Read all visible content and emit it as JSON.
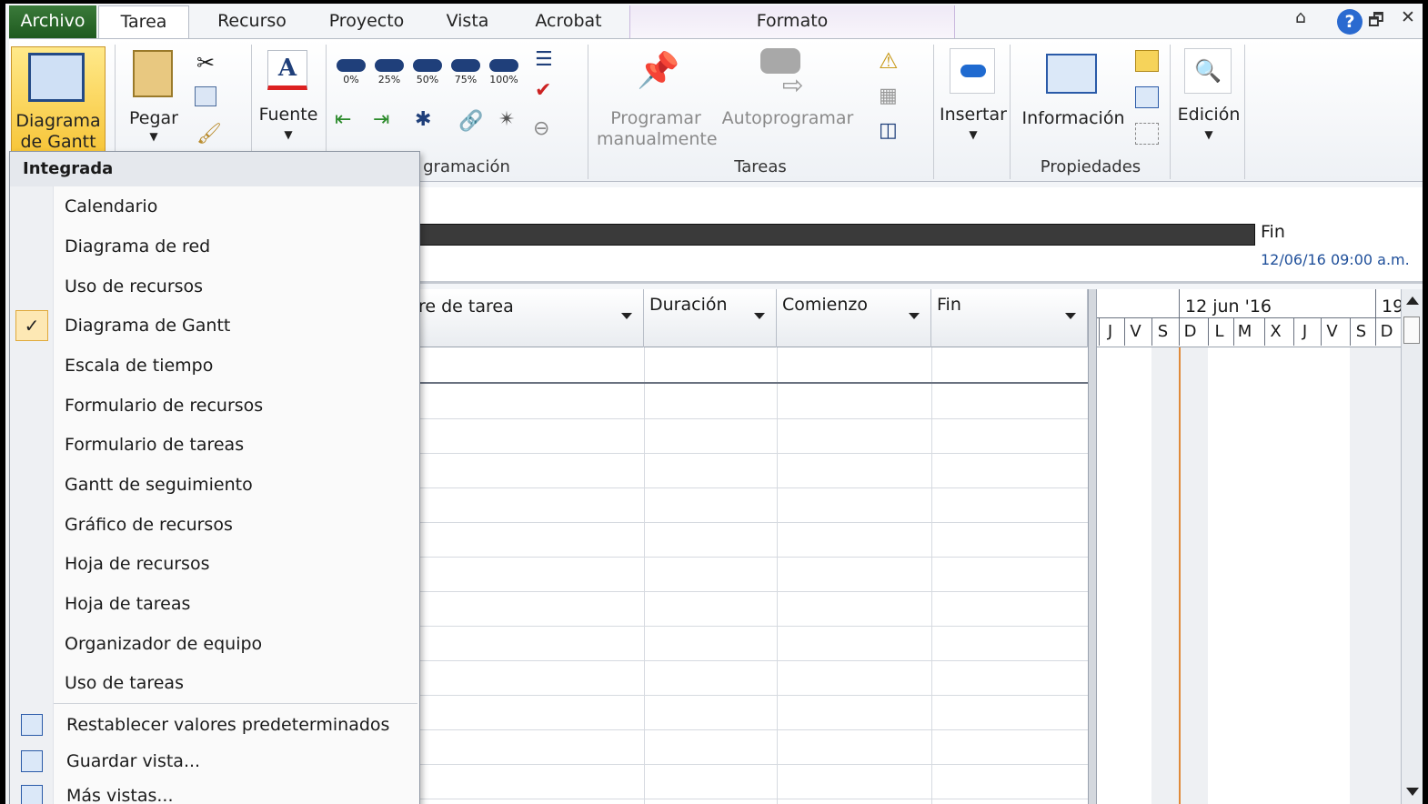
{
  "tabs": {
    "file": "Archivo",
    "task": "Tarea",
    "resource": "Recurso",
    "project": "Proyecto",
    "view": "Vista",
    "acrobat": "Acrobat",
    "format": "Formato"
  },
  "ribbon": {
    "gantt_label_1": "Diagrama",
    "gantt_label_2": "de Gantt",
    "paste": "Pegar",
    "font": "Fuente",
    "pct": [
      "0%",
      "25%",
      "50%",
      "75%",
      "100%"
    ],
    "schedule_group": "gramación",
    "manual_1": "Programar",
    "manual_2": "manualmente",
    "auto": "Autoprogramar",
    "tasks_group": "Tareas",
    "insert": "Insertar",
    "info": "Información",
    "properties_group": "Propiedades",
    "editing": "Edición"
  },
  "timeline": {
    "end_label": "Fin",
    "end_date": "12/06/16 09:00 a.m."
  },
  "grid": {
    "columns": [
      "re de tarea",
      "Duración",
      "Comienzo",
      "Fin"
    ]
  },
  "chart": {
    "week1": "12 jun '16",
    "week2": "19",
    "days": [
      "J",
      "V",
      "S",
      "D",
      "L",
      "M",
      "X",
      "J",
      "V",
      "S",
      "D"
    ]
  },
  "menu": {
    "header": "Integrada",
    "items": [
      "Calendario",
      "Diagrama de red",
      "Uso de recursos",
      "Diagrama de Gantt",
      "Escala de tiempo",
      "Formulario de recursos",
      "Formulario de tareas",
      "Gantt de seguimiento",
      "Gráfico de recursos",
      "Hoja de recursos",
      "Hoja de tareas",
      "Organizador de equipo",
      "Uso de tareas"
    ],
    "checked_index": 3,
    "reset": "Restablecer valores predeterminados",
    "save": "Guardar vista...",
    "more": "Más vistas..."
  },
  "colors": {
    "file_tab": "#2b6b2b",
    "active_button": "#f7c63a",
    "today_line": "#e08a3a"
  }
}
